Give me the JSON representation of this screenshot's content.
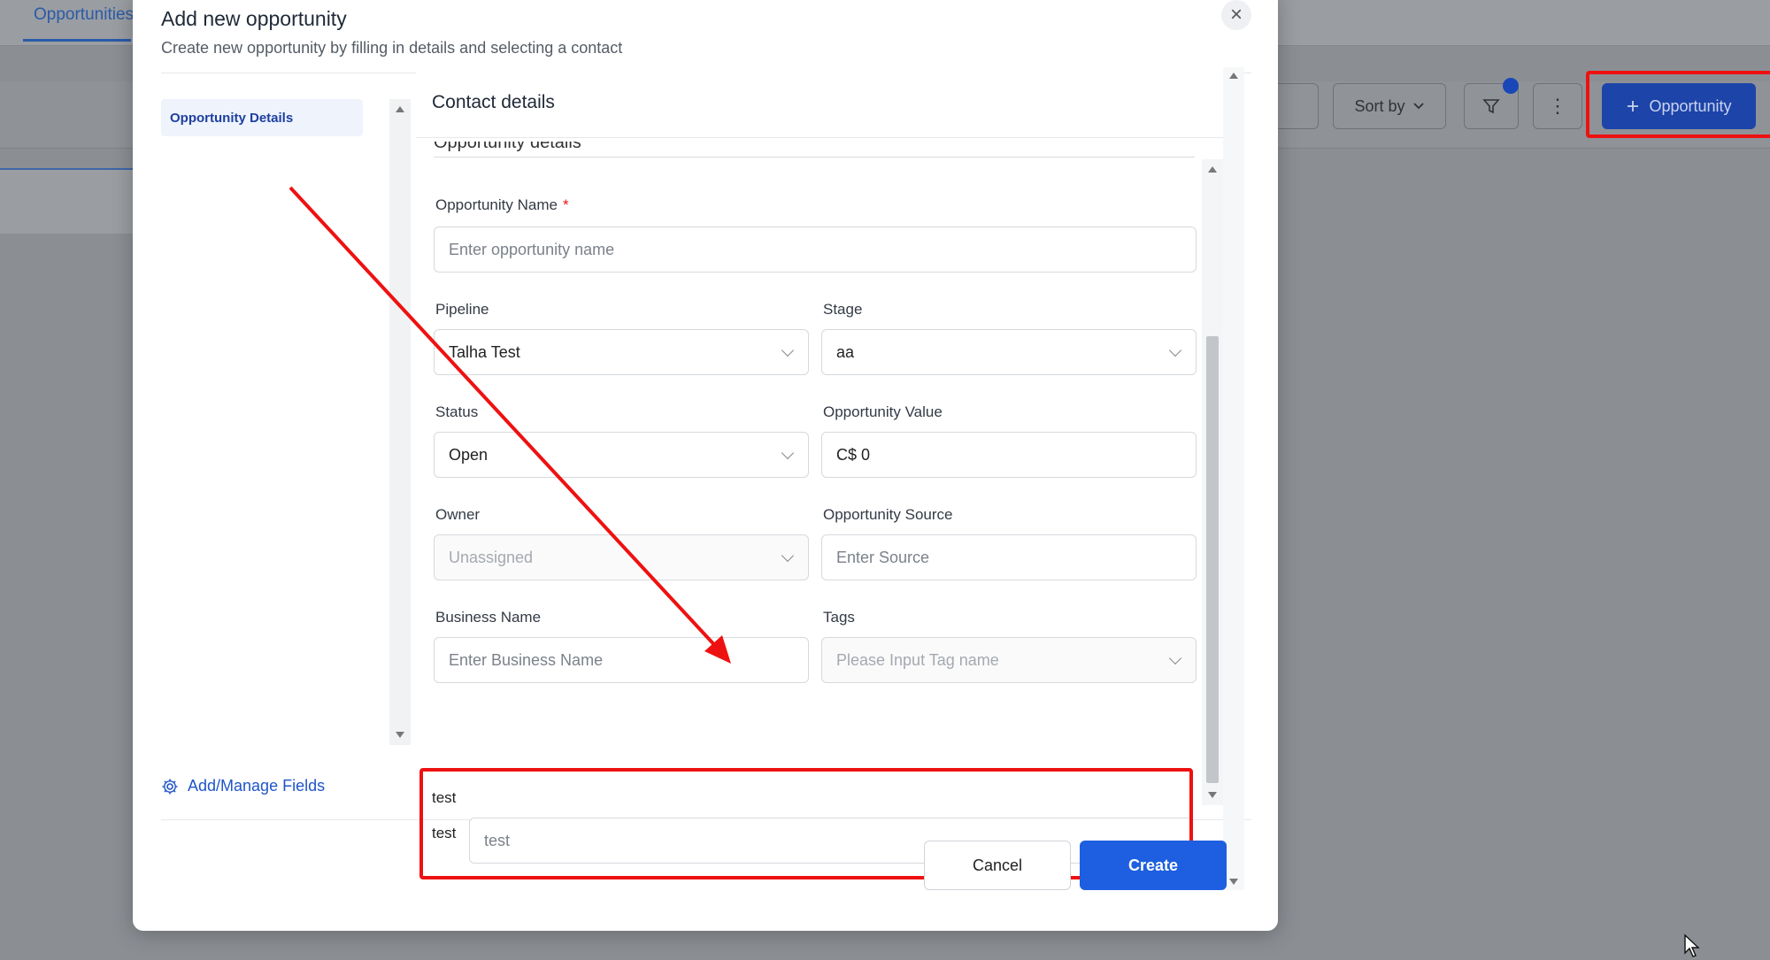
{
  "background": {
    "tab_label": "Opportunities",
    "sort_label": "Sort by",
    "add_button_label": "Opportunity",
    "more_glyph": "⋮"
  },
  "modal": {
    "title": "Add new opportunity",
    "subtitle": "Create new opportunity by filling in details and selecting a contact",
    "close_glyph": "×",
    "side_nav": [
      "Opportunity Details"
    ],
    "manage_fields_label": "Add/Manage Fields",
    "section_header": "Contact details",
    "clipped_section_heading": "Opportunity details",
    "fields": {
      "opportunity_name": {
        "label": "Opportunity Name",
        "required_mark": "*",
        "placeholder": "Enter opportunity name"
      },
      "pipeline": {
        "label": "Pipeline",
        "value": "Talha Test"
      },
      "stage": {
        "label": "Stage",
        "value": "aa"
      },
      "status": {
        "label": "Status",
        "value": "Open"
      },
      "opportunity_value": {
        "label": "Opportunity Value",
        "value": "C$ 0"
      },
      "owner": {
        "label": "Owner",
        "value": "Unassigned"
      },
      "opportunity_source": {
        "label": "Opportunity Source",
        "placeholder": "Enter Source"
      },
      "business_name": {
        "label": "Business Name",
        "placeholder": "Enter Business Name"
      },
      "tags": {
        "label": "Tags",
        "placeholder": "Please Input Tag name"
      }
    },
    "custom_section": {
      "title": "test",
      "field_label": "test",
      "field_placeholder": "test"
    },
    "cancel_label": "Cancel",
    "create_label": "Create"
  },
  "colors": {
    "primary": "#1d5fe0",
    "annotation_red": "#ee1111"
  }
}
